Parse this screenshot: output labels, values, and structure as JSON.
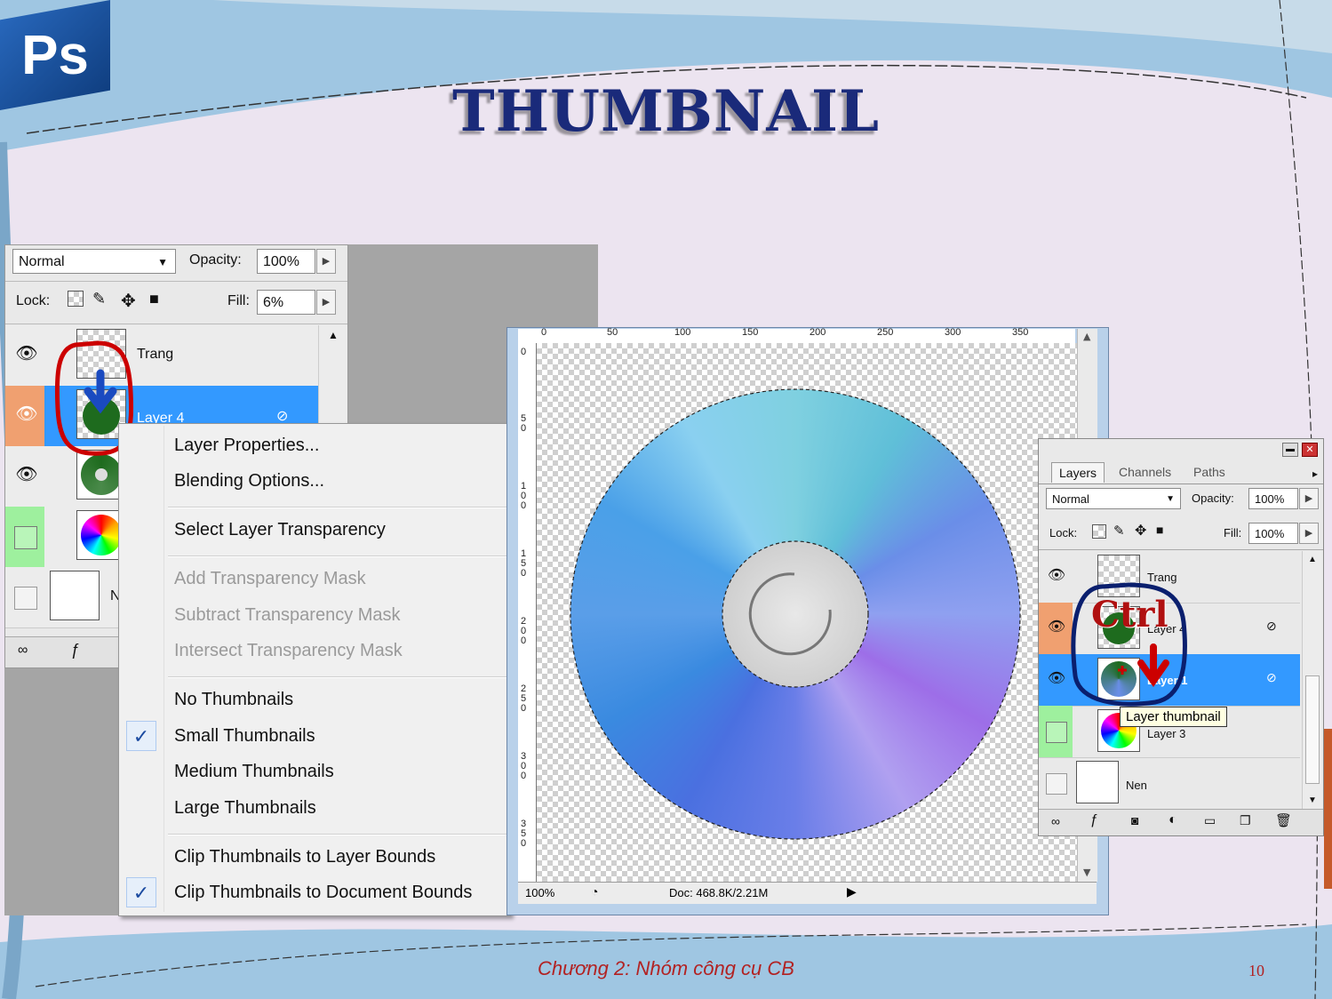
{
  "slide": {
    "logo": "Ps",
    "title": "THUMBNAIL",
    "footer": "Chương 2: Nhóm công cụ CB",
    "page_number": "10"
  },
  "left_panel": {
    "blend_mode": "Normal",
    "opacity_label": "Opacity:",
    "opacity_value": "100%",
    "lock_label": "Lock:",
    "fill_label": "Fill:",
    "fill_value": "6%",
    "layers": [
      {
        "name": "Trang"
      },
      {
        "name": "Layer 4"
      },
      {
        "name": ""
      },
      {
        "name": ""
      },
      {
        "name": "N"
      }
    ]
  },
  "context_menu": {
    "items": [
      {
        "label": "Layer Properties...",
        "disabled": false,
        "checked": false
      },
      {
        "label": "Blending Options...",
        "disabled": false,
        "checked": false
      },
      {
        "label": "Select Layer Transparency",
        "disabled": false,
        "checked": false
      },
      {
        "label": "Add Transparency Mask",
        "disabled": true,
        "checked": false
      },
      {
        "label": "Subtract Transparency Mask",
        "disabled": true,
        "checked": false
      },
      {
        "label": "Intersect Transparency Mask",
        "disabled": true,
        "checked": false
      },
      {
        "label": "No Thumbnails",
        "disabled": false,
        "checked": false
      },
      {
        "label": "Small Thumbnails",
        "disabled": false,
        "checked": true
      },
      {
        "label": "Medium Thumbnails",
        "disabled": false,
        "checked": false
      },
      {
        "label": "Large Thumbnails",
        "disabled": false,
        "checked": false
      },
      {
        "label": "Clip Thumbnails to Layer Bounds",
        "disabled": false,
        "checked": false
      },
      {
        "label": "Clip Thumbnails to Document Bounds",
        "disabled": false,
        "checked": true
      }
    ],
    "check_glyph": "✓"
  },
  "document": {
    "ruler_top_labels": [
      "0",
      "50",
      "100",
      "150",
      "200",
      "250",
      "300",
      "350"
    ],
    "ruler_left_labels": [
      "0",
      "50",
      "100",
      "150",
      "200",
      "250",
      "300",
      "350"
    ],
    "zoom": "100%",
    "doc_info": "Doc: 468.8K/2.21M"
  },
  "right_panel": {
    "tabs": [
      "Layers",
      "Channels",
      "Paths"
    ],
    "blend_mode": "Normal",
    "opacity_label": "Opacity:",
    "opacity_value": "100%",
    "lock_label": "Lock:",
    "fill_label": "Fill:",
    "fill_value": "100%",
    "layers": [
      {
        "name": "Trang"
      },
      {
        "name": "Layer 4"
      },
      {
        "name": "Layer 1"
      },
      {
        "name": "Layer 3"
      },
      {
        "name": "Nen"
      }
    ],
    "tooltip": "Layer thumbnail",
    "annotation": "Ctrl"
  },
  "colors": {
    "selection_blue": "#3399ff",
    "annotation_red": "#cc0000",
    "annotation_navy": "#0a1f6e",
    "footer_red": "#b22222"
  }
}
